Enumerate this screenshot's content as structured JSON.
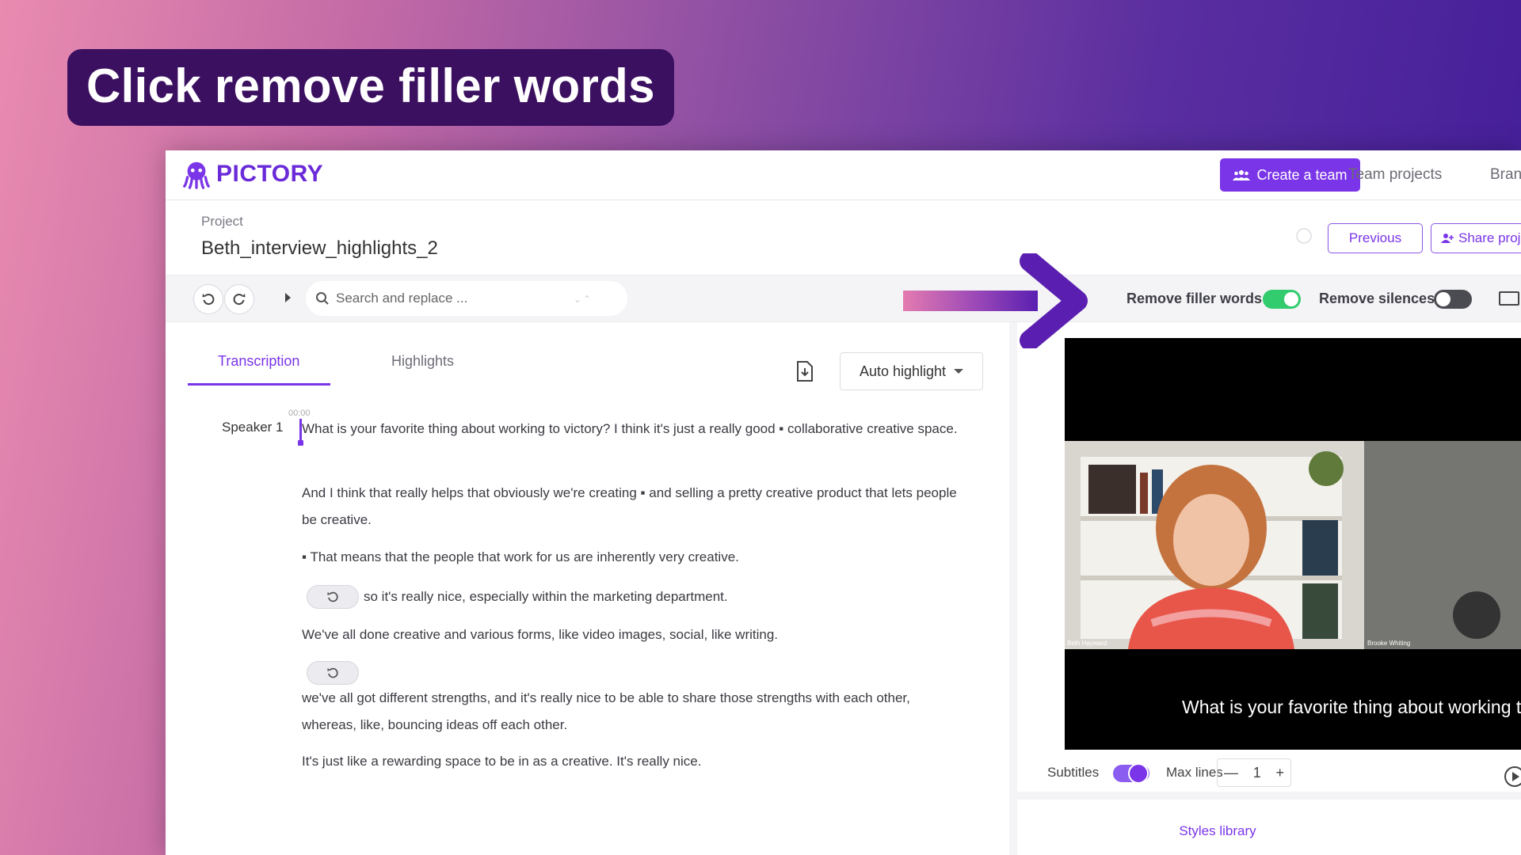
{
  "caption": "Click remove filler words",
  "app": {
    "logo_text": "PICTORY"
  },
  "topnav": {
    "create_team": "Create a team",
    "team_projects": "Team projects",
    "brand": "Bran"
  },
  "project": {
    "label": "Project",
    "name": "Beth_interview_highlights_2",
    "previous": "Previous",
    "share": "Share proj"
  },
  "toolbar": {
    "search_placeholder": "Search and replace ...",
    "remove_filler_words": "Remove filler words",
    "remove_filler_words_on": true,
    "remove_silences": "Remove silences",
    "remove_silences_on": false
  },
  "tabs": {
    "transcription": "Transcription",
    "highlights": "Highlights"
  },
  "auto_highlight": "Auto highlight",
  "transcript": {
    "speaker": "Speaker 1",
    "timestamp": "00:00",
    "paragraphs": [
      "What is your favorite thing about working to victory? I think it's just a really good ▪ collaborative creative space.",
      "And I think that really helps that obviously we're creating ▪ and selling a pretty creative product that lets people be creative.",
      "▪ That means that the people that work for us are inherently very creative.",
      "so it's really nice, especially within the marketing department.",
      "We've all done creative and various forms, like video images, social, like writing.",
      "we've all got different strengths, and it's really nice to be able to share those strengths with each other, whereas, like, bouncing ideas off each other.",
      "It's just like a rewarding space to be in as a creative. It's really nice."
    ]
  },
  "video": {
    "name_left": "Beth Hayward",
    "name_right": "Brooke Whiting",
    "subtitle": "What is your favorite thing about working t"
  },
  "controls": {
    "subtitles": "Subtitles",
    "subtitles_on": true,
    "max_lines": "Max lines",
    "max_lines_value": "1",
    "minus": "—",
    "plus": "+"
  },
  "styles_library": "Styles library",
  "colors": {
    "accent": "#7b35e8",
    "toggle_on": "#32cc6e",
    "caption_bg": "#3b1060"
  }
}
